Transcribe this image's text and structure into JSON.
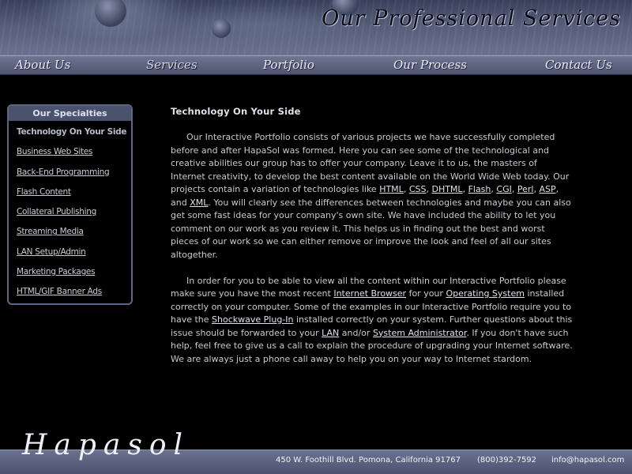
{
  "header": {
    "title": "Our Professional Services"
  },
  "nav": {
    "items": [
      {
        "label": "About Us"
      },
      {
        "label": "Services"
      },
      {
        "label": "Portfolio"
      },
      {
        "label": "Our Process"
      },
      {
        "label": "Contact Us"
      }
    ]
  },
  "sidebar": {
    "title": "Our Specialties",
    "items": [
      {
        "label": "Technology On Your Side"
      },
      {
        "label": "Business Web Sites"
      },
      {
        "label": "Back-End Programming"
      },
      {
        "label": "Flash Content"
      },
      {
        "label": "Collateral Publishing"
      },
      {
        "label": "Streaming Media"
      },
      {
        "label": "LAN Setup/Admin"
      },
      {
        "label": "Marketing Packages"
      },
      {
        "label": "HTML/GIF Banner Ads"
      }
    ]
  },
  "main": {
    "title": "Technology On Your Side",
    "p1": {
      "t1": "Our Interactive Portfolio consists of various projects we have successfully completed before and after HapaSol was formed. Here you can see some of the technological and creative abilities our group has to offer your company. Leave it to us, the masters of Internet creativity, to develop the best content available on the World Wide Web today. Our projects contain a variation of technologies like ",
      "l1": "HTML",
      "s1": ", ",
      "l2": "CSS",
      "s2": ", ",
      "l3": "DHTML",
      "s3": ", ",
      "l4": "Flash",
      "s4": ", ",
      "l5": "CGI",
      "s5": ", ",
      "l6": "Perl",
      "s6": ", ",
      "l7": "ASP",
      "s7": ", and ",
      "l8": "XML",
      "t2": ". You will clearly see the differences between technologies and maybe you can also get some fast ideas for your company's own site. We have included the ability to let you comment on our work as you review it. This helps us in finding out the best and worst pieces of our work so we can either remove or improve the look and feel of all our sites altogether."
    },
    "p2": {
      "t1": "In order for you to be able to view all the content within our Interactive Portfolio please make sure you have the most recent ",
      "l1": "Internet Browser",
      "s1": " for your ",
      "l2": "Operating System",
      "t2": " installed correctly on your computer. Some of the examples in our Interactive Portfolio require you to have the ",
      "l3": "Shockwave Plug-In",
      "t3": " installed correctly on your system. Further questions about this issue should be forwarded to your ",
      "l4": "LAN",
      "s2": " and/or ",
      "l5": "System Administrator",
      "t4": ". If you don't have such help, feel free to give us a call to explain the procedure of upgrading your Internet software. We are always just a phone call away to help you on your way to Internet stardom."
    }
  },
  "footer": {
    "logo": "Hapasol",
    "address": "450 W. Foothill Blvd. Pomona, California 91767",
    "phone": "(800)392-7592",
    "email": "info@hapasol.com"
  }
}
